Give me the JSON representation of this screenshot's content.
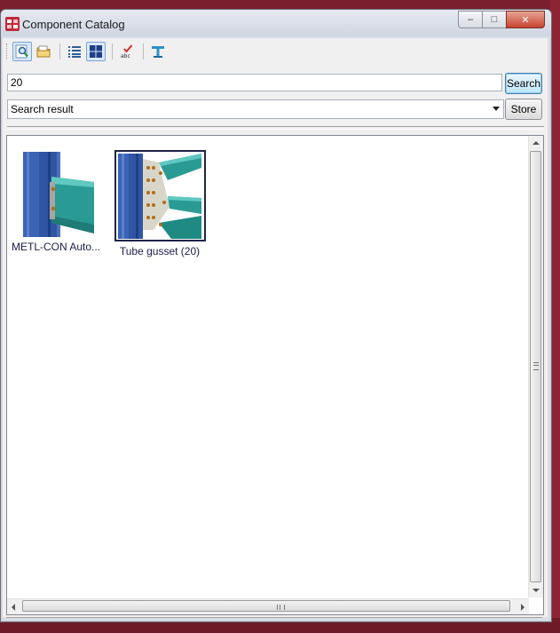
{
  "window": {
    "title": "Component Catalog",
    "controls": {
      "minimize": "–",
      "maximize": "□",
      "close": "✕"
    }
  },
  "toolbar": {
    "buttons": [
      {
        "name": "find-icon",
        "active": true
      },
      {
        "name": "folder-icon",
        "active": false
      },
      {
        "name": "list-view-icon",
        "active": false
      },
      {
        "name": "thumbnail-view-icon",
        "active": true
      },
      {
        "name": "spellcheck-icon",
        "active": false
      },
      {
        "name": "profile-icon",
        "active": false
      }
    ]
  },
  "search": {
    "value": "20",
    "button_label": "Search"
  },
  "group": {
    "selected": "Search result",
    "store_label": "Store"
  },
  "results": [
    {
      "label": "METL-CON Auto...",
      "selected": false
    },
    {
      "label": "Tube gusset (20)",
      "selected": true
    }
  ],
  "colors": {
    "column_blue": "#3b63b5",
    "beam_teal": "#2fa6a0",
    "selection_border": "#1f2546",
    "search_button": "#bee6fd"
  }
}
